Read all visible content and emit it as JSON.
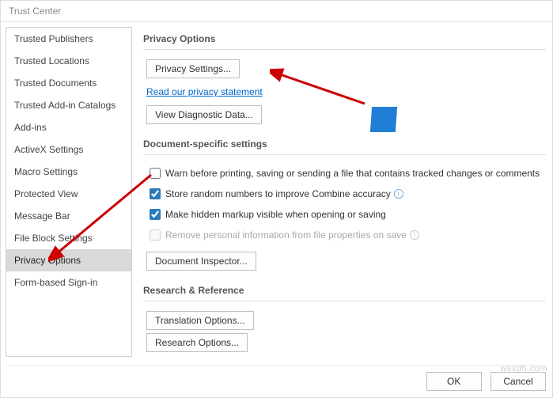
{
  "title": "Trust Center",
  "sidebar": {
    "items": [
      {
        "label": "Trusted Publishers"
      },
      {
        "label": "Trusted Locations"
      },
      {
        "label": "Trusted Documents"
      },
      {
        "label": "Trusted Add-in Catalogs"
      },
      {
        "label": "Add-ins"
      },
      {
        "label": "ActiveX Settings"
      },
      {
        "label": "Macro Settings"
      },
      {
        "label": "Protected View"
      },
      {
        "label": "Message Bar"
      },
      {
        "label": "File Block Settings"
      },
      {
        "label": "Privacy Options"
      },
      {
        "label": "Form-based Sign-in"
      }
    ],
    "selected_index": 10
  },
  "sections": {
    "privacy": {
      "heading": "Privacy Options",
      "settings_btn": "Privacy Settings...",
      "privacy_link": "Read our privacy statement",
      "diagnostic_btn": "View Diagnostic Data..."
    },
    "doc": {
      "heading": "Document-specific settings",
      "c1": "Warn before printing, saving or sending a file that contains tracked changes or comments",
      "c2": "Store random numbers to improve Combine accuracy",
      "c3": "Make hidden markup visible when opening or saving",
      "c4": "Remove personal information from file properties on save",
      "inspector_btn": "Document Inspector..."
    },
    "research": {
      "heading": "Research & Reference",
      "translation_btn": "Translation Options...",
      "research_btn": "Research Options..."
    }
  },
  "footer": {
    "ok": "OK",
    "cancel": "Cancel"
  },
  "watermark": "wsxdh.com"
}
